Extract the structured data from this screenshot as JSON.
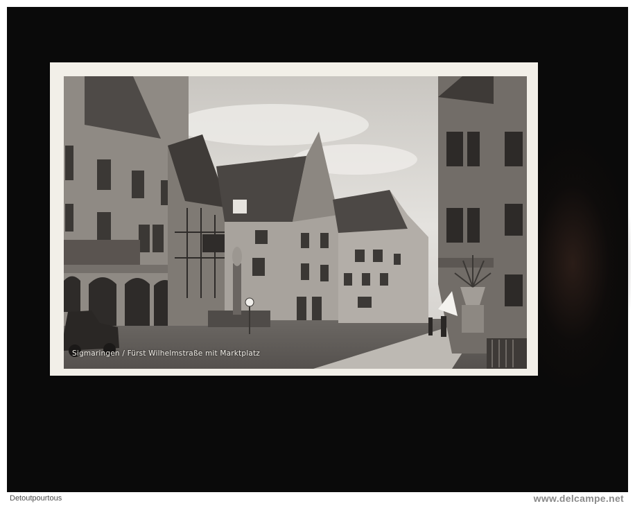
{
  "postcard": {
    "caption": "Sigmaringen / Fürst Wilhelmstraße mit Marktplatz"
  },
  "footer": {
    "seller": "Detoutpourtous",
    "site": "www.delcampe.net"
  },
  "colors": {
    "scan_background": "#0a0a0a",
    "card_border": "#f2efe8",
    "page_background": "#ffffff"
  }
}
